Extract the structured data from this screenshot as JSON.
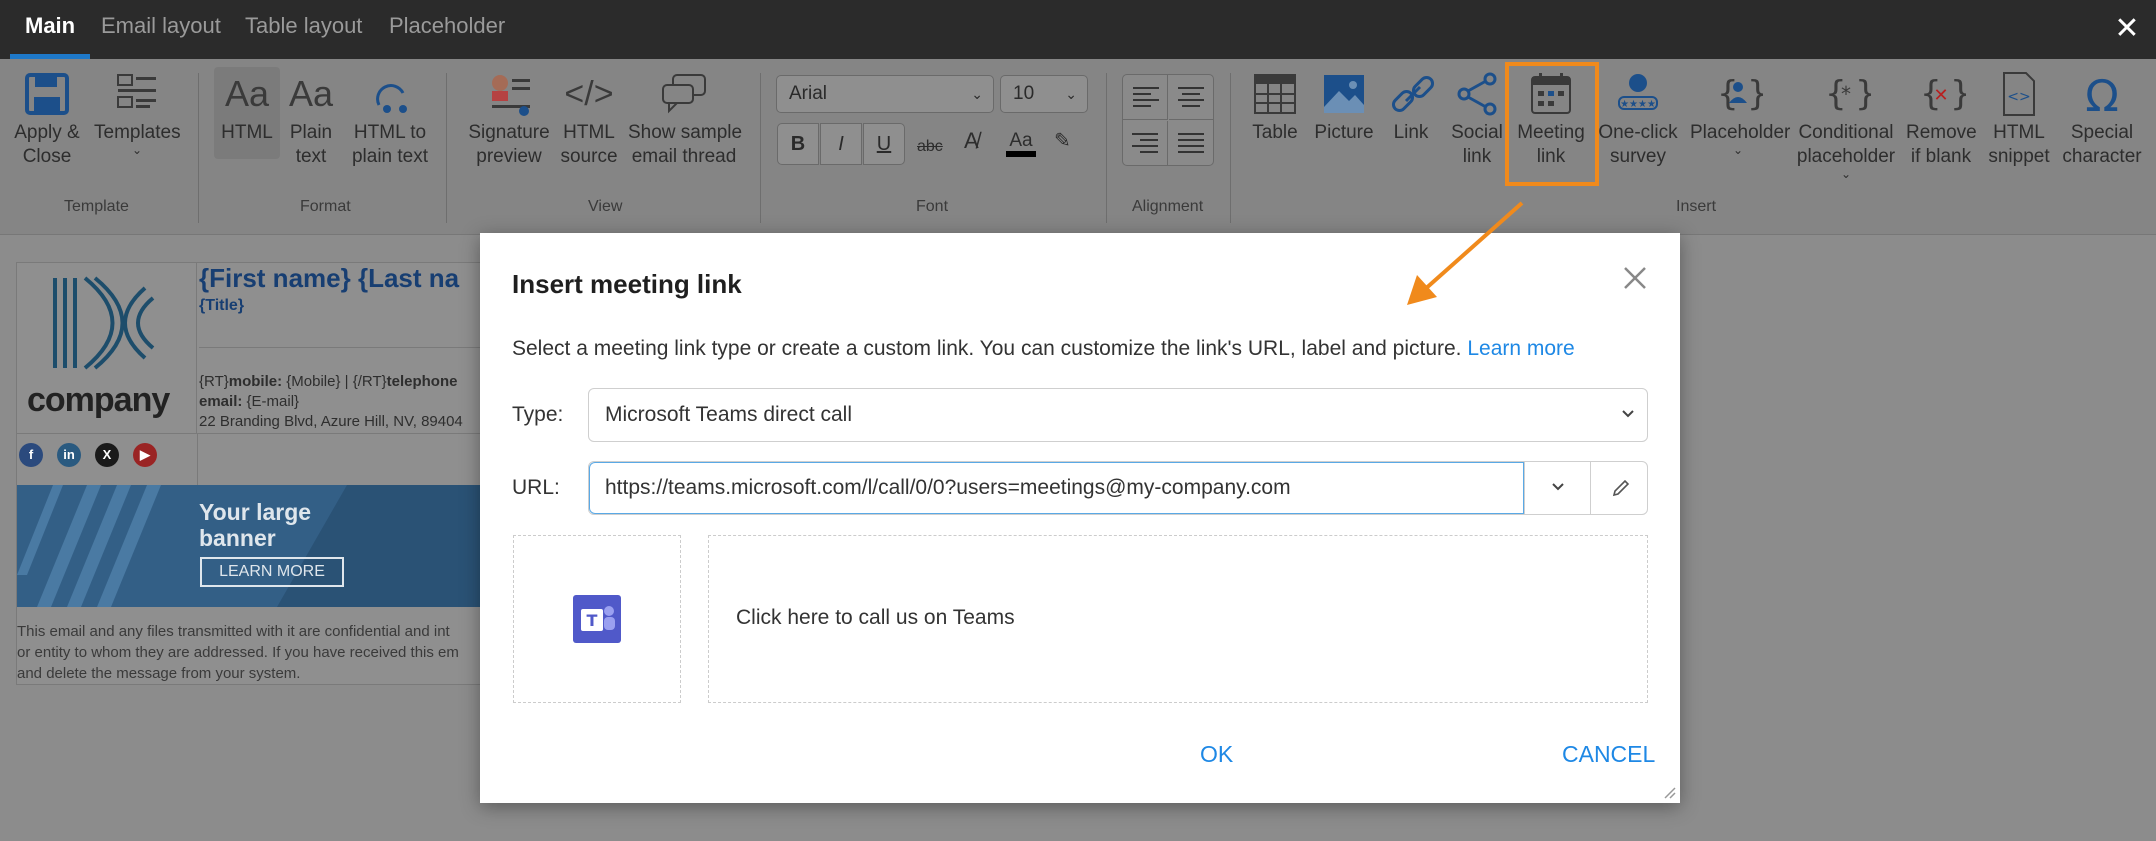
{
  "tabs": [
    {
      "label": "Main",
      "active": true
    },
    {
      "label": "Email layout",
      "active": false
    },
    {
      "label": "Table layout",
      "active": false
    },
    {
      "label": "Placeholder",
      "active": false
    }
  ],
  "ribbon": {
    "template": {
      "group": "Template",
      "apply_close": "Apply &\nClose",
      "apply_close_l1": "Apply &",
      "apply_close_l2": "Close",
      "templates": "Templates"
    },
    "format": {
      "group": "Format",
      "html": "HTML",
      "plain_l1": "Plain",
      "plain_l2": "text",
      "html2plain_l1": "HTML to",
      "html2plain_l2": "plain text"
    },
    "view": {
      "group": "View",
      "sig_l1": "Signature",
      "sig_l2": "preview",
      "src_l1": "HTML",
      "src_l2": "source",
      "thread_l1": "Show sample",
      "thread_l2": "email thread"
    },
    "font": {
      "group": "Font",
      "family": "Arial",
      "size": "10",
      "bold": "B",
      "italic": "I",
      "underline": "U",
      "strike": "abc",
      "color_glyph": "Aa"
    },
    "alignment": {
      "group": "Alignment"
    },
    "insert": {
      "group": "Insert",
      "table": "Table",
      "picture": "Picture",
      "link": "Link",
      "social_l1": "Social",
      "social_l2": "link",
      "meeting_l1": "Meeting",
      "meeting_l2": "link",
      "survey_l1": "One-click",
      "survey_l2": "survey",
      "placeholder": "Placeholder",
      "cond_l1": "Conditional",
      "cond_l2": "placeholder",
      "remove_l1": "Remove",
      "remove_l2": "if blank",
      "snippet_l1": "HTML",
      "snippet_l2": "snippet",
      "special_l1": "Special",
      "special_l2": "character"
    }
  },
  "signature": {
    "logo_word": "company",
    "name": "{First name} {Last na",
    "title": "{Title}",
    "contact_l1_pre": "{RT}",
    "contact_l1_mobile": "mobile:",
    "contact_l1_rest": " {Mobile}  |  {/RT}",
    "contact_l1_tel": "telephone",
    "contact_l2_email": "email:",
    "contact_l2_rest": " {E-mail}",
    "contact_l3": "22 Branding Blvd, Azure Hill, NV, 89404",
    "banner_l1": "Your large",
    "banner_l2": "banner",
    "banner_button": "LEARN MORE",
    "disclaimer_l1": "This email and any files transmitted with it are confidential and int",
    "disclaimer_l2": "or entity to whom they are addressed. If you have received this em",
    "disclaimer_l3": "and delete the message from your system."
  },
  "dialog": {
    "title": "Insert meeting link",
    "description": "Select a meeting link type or create a custom link. You can customize the link's URL, label and picture. ",
    "learn_more": "Learn more",
    "type_label": "Type:",
    "type_value": "Microsoft Teams direct call",
    "url_label": "URL:",
    "url_value": "https://teams.microsoft.com/l/call/0/0?users=meetings@my-company.com",
    "link_label": "Click here to call us on Teams",
    "ok": "OK",
    "cancel": "CANCEL"
  },
  "colors": {
    "accent": "#1e88e5",
    "highlight": "#f08a1c",
    "teams": "#5059c9"
  }
}
